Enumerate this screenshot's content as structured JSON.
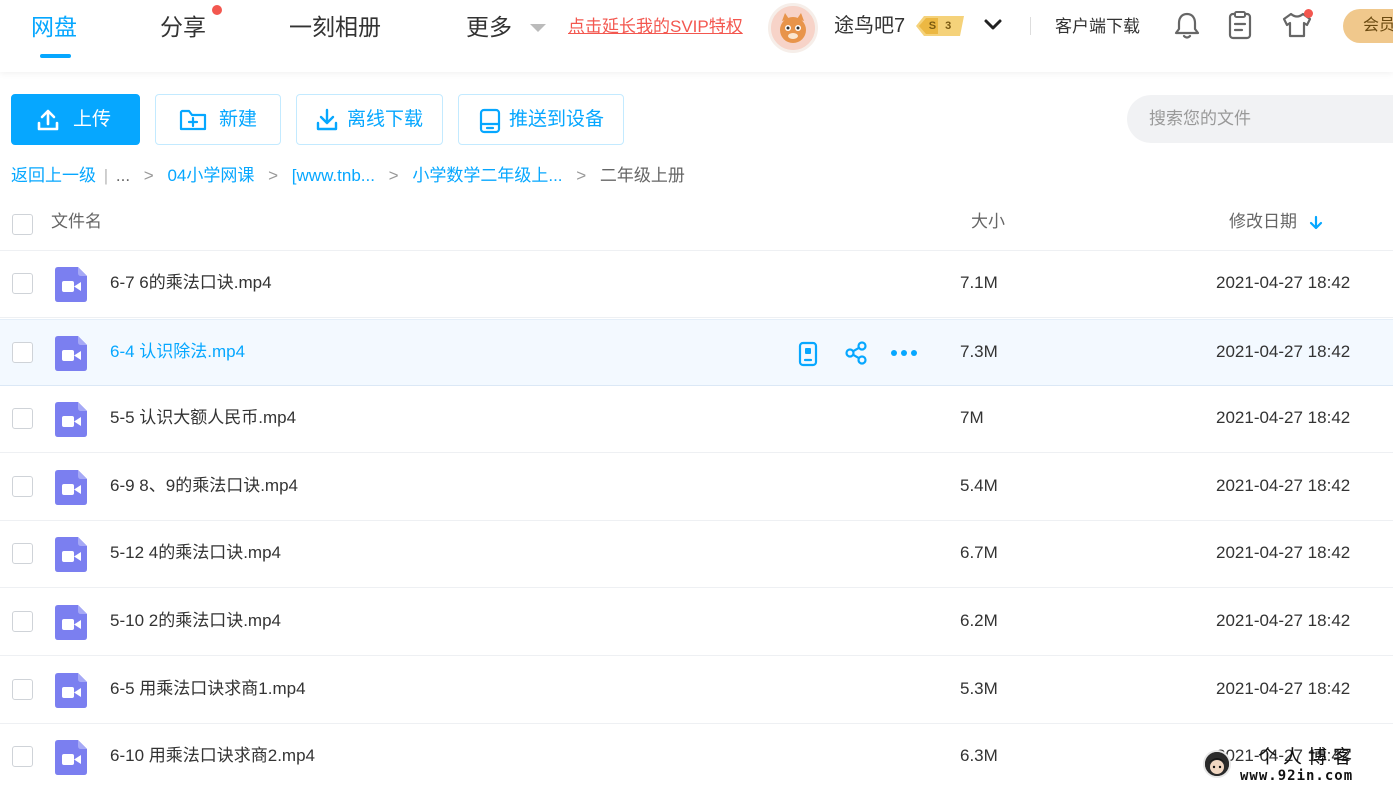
{
  "nav": {
    "items": [
      {
        "label": "网盘",
        "active": true
      },
      {
        "label": "分享",
        "active": false,
        "dot": true
      },
      {
        "label": "一刻相册",
        "active": false
      },
      {
        "label": "更多",
        "active": false
      }
    ],
    "svip_promo": "点击延长我的SVIP特权",
    "username": "途鸟吧7",
    "vip_level": "3",
    "vip_tier": "S",
    "client_download": "客户端下载",
    "member_button": "会员"
  },
  "toolbar": {
    "upload": "上传",
    "new": "新建",
    "offline_download": "离线下载",
    "push_device": "推送到设备",
    "search_placeholder": "搜索您的文件"
  },
  "breadcrumb": {
    "back": "返回上一级",
    "sep": "|",
    "ellipsis": "...",
    "path": [
      "04小学网课",
      "[www.tnb...",
      "小学数学二年级上..."
    ],
    "current": "二年级上册"
  },
  "table": {
    "columns": {
      "name": "文件名",
      "size": "大小",
      "date": "修改日期"
    },
    "sort_column": "date",
    "rows": [
      {
        "name": "6-7 6的乘法口诀.mp4",
        "size": "7.1M",
        "date": "2021-04-27 18:42"
      },
      {
        "name": "6-4 认识除法.mp4",
        "size": "7.3M",
        "date": "2021-04-27 18:42",
        "hover": true
      },
      {
        "name": "5-5 认识大额人民币.mp4",
        "size": "7M",
        "date": "2021-04-27 18:42"
      },
      {
        "name": "6-9 8、9的乘法口诀.mp4",
        "size": "5.4M",
        "date": "2021-04-27 18:42"
      },
      {
        "name": "5-12 4的乘法口诀.mp4",
        "size": "6.7M",
        "date": "2021-04-27 18:42"
      },
      {
        "name": "5-10 2的乘法口诀.mp4",
        "size": "6.2M",
        "date": "2021-04-27 18:42"
      },
      {
        "name": "6-5 用乘法口诀求商1.mp4",
        "size": "5.3M",
        "date": "2021-04-27 18:42"
      },
      {
        "name": "6-10 用乘法口诀求商2.mp4",
        "size": "6.3M",
        "date": "2021-04-27 18:42"
      }
    ]
  },
  "watermark": {
    "title": "个人博客",
    "url": "www.92in.com"
  },
  "colors": {
    "accent": "#06a7ff",
    "promo_red": "#f3574f",
    "video_icon": "#7b7ff0",
    "hover_row": "#f3f9ff",
    "member_gold": "#f0c88c"
  }
}
